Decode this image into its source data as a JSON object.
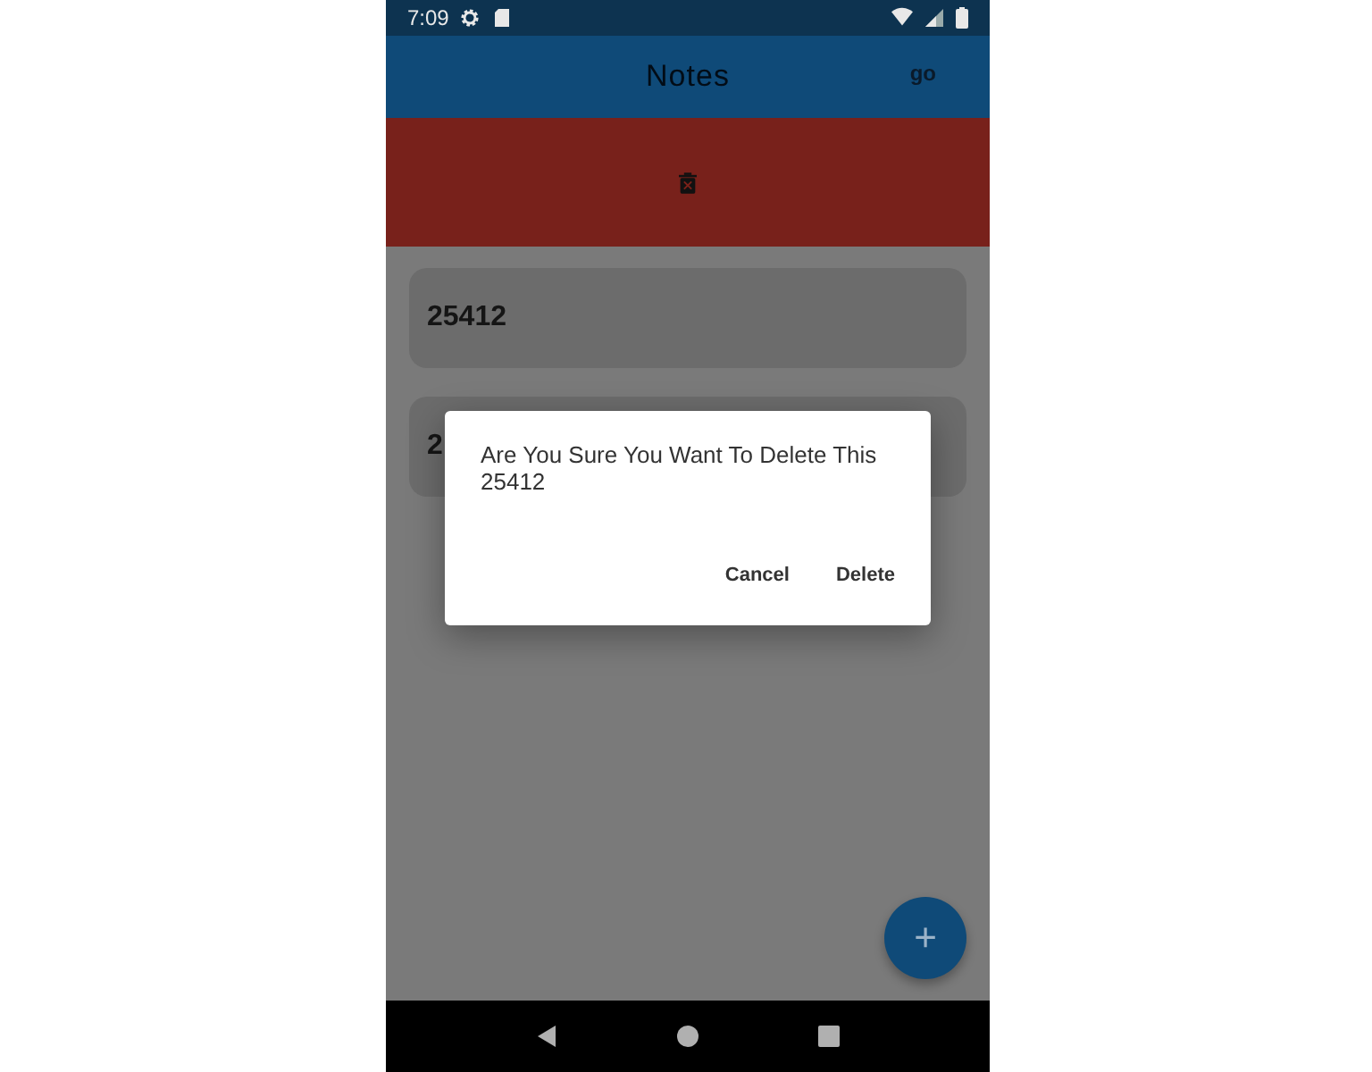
{
  "status_bar": {
    "time": "7:09"
  },
  "app_bar": {
    "title": "Notes",
    "action": "go"
  },
  "notes": [
    {
      "text": "25412"
    },
    {
      "text": "2"
    }
  ],
  "dialog": {
    "message": "Are You Sure You Want To Delete This 25412",
    "buttons": [
      "Cancel",
      "Delete"
    ]
  },
  "fab": {
    "label": "+"
  }
}
